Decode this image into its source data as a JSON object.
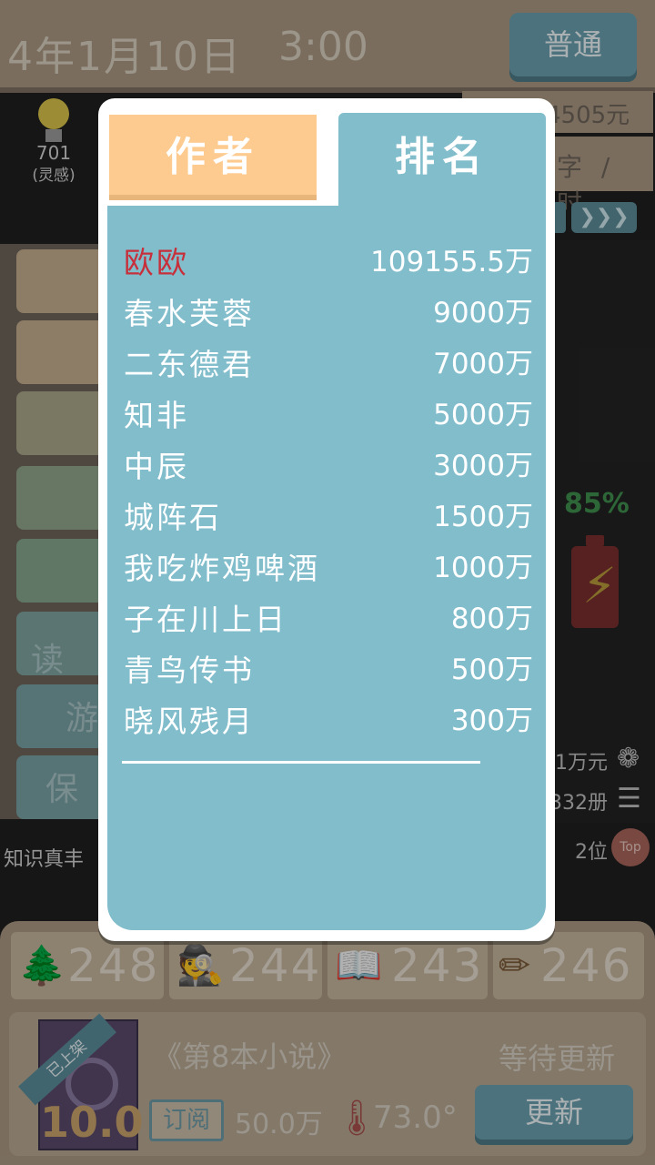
{
  "header": {
    "date": "4年1月10日",
    "time": "3:00",
    "mode_button": "普通"
  },
  "sidebar_status": {
    "inspiration_value": "701",
    "inspiration_label": "(灵感)",
    "money_partial": "4505元",
    "speed_partial": "字 / 时"
  },
  "right_stats": {
    "battery_percent": "85%",
    "income_partial": "1万元",
    "copies_partial": "332册",
    "rank_partial": "2位",
    "top_badge": "Top"
  },
  "left_menu": {
    "item_partial_1": "读",
    "item_partial_2": "游",
    "item_partial_3": "保",
    "knowledge_text": "知识真丰"
  },
  "stats_bar": {
    "tree_value": "248",
    "detective_value": "244",
    "book_value": "243",
    "pencil_value": "246"
  },
  "novel": {
    "shelf_ribbon": "已上架",
    "score": "10.0",
    "title": "《第8本小说》",
    "status": "等待更新",
    "subscribe_label": "订阅",
    "subscribe_amount": "50.0万",
    "temperature": "73.0°",
    "update_button": "更新"
  },
  "modal": {
    "tab_author": "作者",
    "tab_rank": "排名",
    "active_tab": "排名",
    "rankings": [
      {
        "name": "欧欧",
        "value": "109155.5万",
        "highlight": true
      },
      {
        "name": "春水芙蓉",
        "value": "9000万"
      },
      {
        "name": "二东德君",
        "value": "7000万"
      },
      {
        "name": "知非",
        "value": "5000万"
      },
      {
        "name": "中辰",
        "value": "3000万"
      },
      {
        "name": "城阵石",
        "value": "1500万"
      },
      {
        "name": "我吃炸鸡啤酒",
        "value": "1000万"
      },
      {
        "name": "子在川上日",
        "value": "800万"
      },
      {
        "name": "青鸟传书",
        "value": "500万"
      },
      {
        "name": "晓风残月",
        "value": "300万"
      }
    ]
  },
  "colors": {
    "highlight_name": "#c7303a",
    "modal_panel": "#82bdcc",
    "author_tab": "#fdcb8f"
  }
}
